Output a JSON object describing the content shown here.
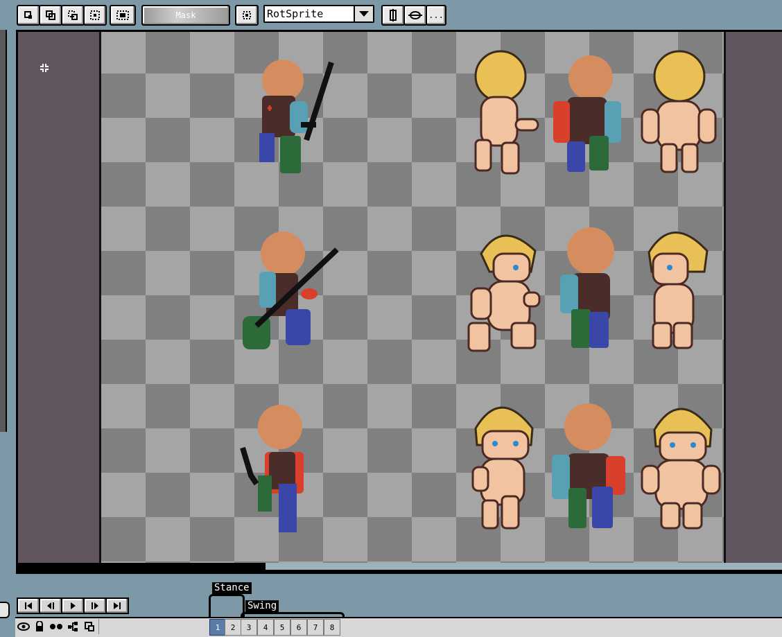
{
  "toolbar": {
    "mask_label": "Mask",
    "algorithm_value": "RotSprite",
    "more_label": "..."
  },
  "timeline": {
    "tags": [
      {
        "label": "Stance"
      },
      {
        "label": "Swing"
      }
    ],
    "frames": [
      "1",
      "2",
      "3",
      "4",
      "5",
      "6",
      "7",
      "8"
    ],
    "current_frame": "1"
  },
  "colors": {
    "workspace": "#615560",
    "checker_light": "#a5a5a5",
    "checker_dark": "#808080",
    "background": "#7d98a6",
    "skin_placeholder": "#d58c5e",
    "torso": "#4a2c29",
    "arm_left": "#58a0b4",
    "arm_right": "#d8402c",
    "leg_left": "#3b47a8",
    "leg_right": "#2d6a3a",
    "hair": "#e8c055",
    "skin": "#f1c3a0"
  }
}
